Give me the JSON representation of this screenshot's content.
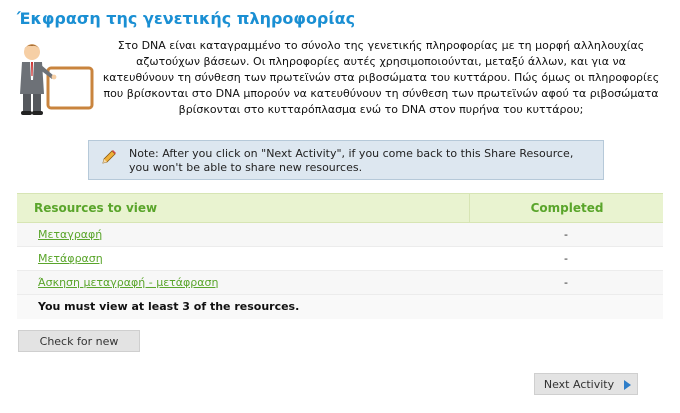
{
  "title": "Έκφραση της γενετικής πληροφορίας",
  "intro": "Στο DNA είναι καταγραμμένο το σύνολο της γενετικής πληροφορίας με τη μορφή αλληλουχίας αζωτούχων βάσεων. Οι πληροφορίες αυτές χρησιμοποιούνται, μεταξύ άλλων, και για να κατευθύνουν τη σύνθεση των πρωτεϊνών στα ριβοσώματα του κυττάρου. Πώς όμως οι πληροφορίες που βρίσκονται στο DNA μπορούν να κατευθύνουν τη σύνθεση των πρωτεϊνών αφού τα ριβοσώματα βρίσκονται στο κυτταρόπλασμα ενώ το DNA στον πυρήνα του κυττάρου;",
  "note": "Note: After you click on \"Next Activity\", if you come back to this Share Resource, you won't be able to share new resources.",
  "table": {
    "headers": {
      "resources": "Resources to view",
      "completed": "Completed"
    },
    "rows": [
      {
        "name": "Μεταγραφή",
        "completed": "-"
      },
      {
        "name": "Μετάφραση",
        "completed": "-"
      },
      {
        "name": "Άσκηση μεταγραφή - μετάφραση",
        "completed": "-"
      }
    ],
    "requirement": "You must view at least 3 of the resources."
  },
  "buttons": {
    "check": "Check for new",
    "next": "Next Activity"
  },
  "colors": {
    "title": "#1a8fd3",
    "link": "#5aa52b",
    "header_bg": "#e9f3d0",
    "note_bg": "#dde7f0"
  },
  "icons": {
    "note": "pencil-icon",
    "next": "play-arrow-icon",
    "illustration": "teacher-with-board-icon"
  }
}
